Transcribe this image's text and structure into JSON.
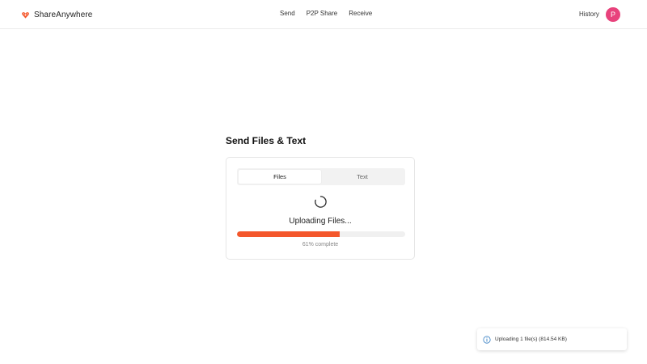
{
  "app": {
    "name": "ShareAnywhere",
    "logo_icon": "heart-sparkle-icon",
    "brand_color": "#f4572b"
  },
  "nav": {
    "items": [
      {
        "label": "Send"
      },
      {
        "label": "P2P Share"
      },
      {
        "label": "Receive"
      }
    ]
  },
  "header": {
    "history_label": "History",
    "avatar_initial": "P",
    "avatar_color": "#e8427c"
  },
  "main": {
    "title": "Send Files & Text",
    "tabs": [
      {
        "label": "Files",
        "active": true
      },
      {
        "label": "Text",
        "active": false
      }
    ],
    "spinner_icon": "loading-spinner-icon",
    "status": "Uploading Files...",
    "progress": {
      "percent": 61,
      "label": "61% complete",
      "fill_color": "#f4572b"
    }
  },
  "toast": {
    "icon": "info-icon",
    "message": "Uploading 1 file(s) (814.54 KB)"
  }
}
